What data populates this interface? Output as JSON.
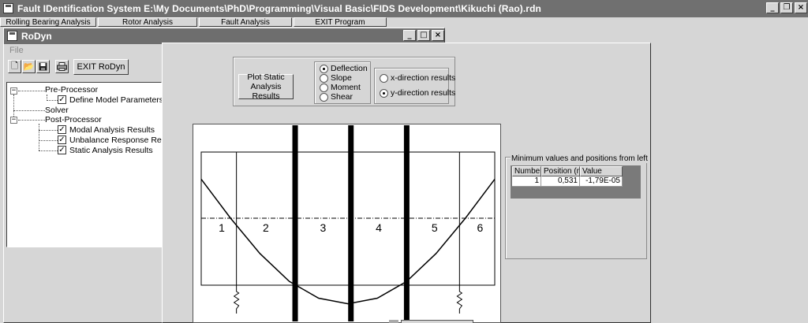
{
  "main_window": {
    "title": "Fault IDentification System   E:\\My Documents\\PhD\\Programming\\Visual Basic\\FIDS Development\\Kikuchi (Rao).rdn",
    "tabs": [
      "Rolling Bearing Analysis",
      "Rotor Analysis",
      "Fault Analysis",
      "EXIT Program"
    ]
  },
  "rodyn_window": {
    "title": "RoDyn",
    "menu_file": "File",
    "toolbar": {
      "exit_label": "EXIT RoDyn",
      "icons": [
        "new-icon",
        "open-icon",
        "save-icon",
        "print-icon"
      ]
    },
    "tree": [
      {
        "label": "Pre-Processor",
        "level": 0,
        "expander": "−"
      },
      {
        "label": "Define Model Parameters",
        "level": 1,
        "checked": true
      },
      {
        "label": "Solver",
        "level": 0
      },
      {
        "label": "Post-Processor",
        "level": 0,
        "expander": "−"
      },
      {
        "label": "Modal Analysis Results",
        "level": 1,
        "checked": true
      },
      {
        "label": "Unbalance Response Results",
        "level": 1,
        "checked": true
      },
      {
        "label": "Static Analysis Results",
        "level": 1,
        "checked": true
      }
    ]
  },
  "static_panel": {
    "plot_button": "Plot Static Analysis Results",
    "result_type": {
      "options": [
        "Deflection",
        "Slope",
        "Moment",
        "Shear"
      ],
      "selected": "Deflection"
    },
    "direction": {
      "options": [
        "x-direction results",
        "y-direction results"
      ],
      "selected": "y-direction results"
    },
    "min_table": {
      "title": "Minimum values and positions from left",
      "columns": [
        "Number",
        "Position (m)",
        "Value"
      ],
      "rows": [
        [
          "1",
          "0,531",
          "-1,79E-05"
        ]
      ]
    }
  },
  "chart_data": {
    "type": "line",
    "title": "",
    "xlabel": "",
    "ylabel": "",
    "element_labels": [
      "1",
      "2",
      "3",
      "4",
      "5",
      "6"
    ],
    "series": [
      {
        "x": [
          0,
          0.1,
          0.2,
          0.3,
          0.4,
          0.5,
          0.6,
          0.7,
          0.8,
          0.9,
          1.0
        ],
        "y": [
          0.42,
          0.0,
          -0.38,
          -0.68,
          -0.86,
          -0.92,
          -0.86,
          -0.68,
          -0.38,
          0.0,
          0.42
        ]
      }
    ],
    "grid": false
  },
  "colors": {
    "title_bar": "#707070",
    "window_bg": "#d6d6d6",
    "plot_bg": "#ffffff"
  }
}
